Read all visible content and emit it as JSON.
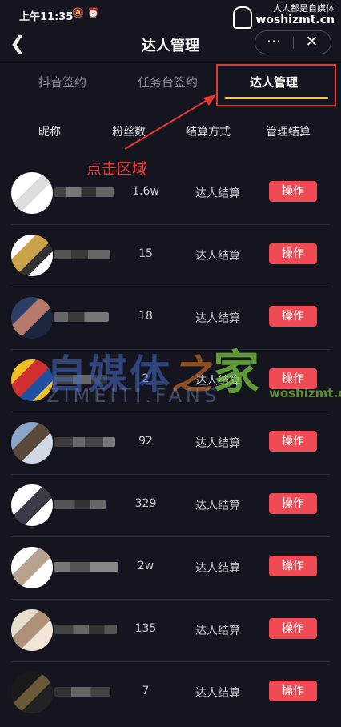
{
  "status_bar": {
    "time": "上午11:35"
  },
  "watermark_top": {
    "line1": "人人都是自媒体",
    "line2": "woshizmt.cn"
  },
  "nav": {
    "title": "达人管理",
    "more_label": "···"
  },
  "tabs": [
    {
      "label": "抖音签约",
      "selected": false
    },
    {
      "label": "任务台签约",
      "selected": false
    },
    {
      "label": "达人管理",
      "selected": true
    }
  ],
  "columns": [
    "昵称",
    "粉丝数",
    "结算方式",
    "管理结算"
  ],
  "annotation": "点击区域",
  "rows": [
    {
      "fans": "1.6w",
      "settle": "达人结算",
      "action": "操作"
    },
    {
      "fans": "15",
      "settle": "达人结算",
      "action": "操作"
    },
    {
      "fans": "18",
      "settle": "达人结算",
      "action": "操作"
    },
    {
      "fans": "2",
      "settle": "达人结算",
      "action": "操作"
    },
    {
      "fans": "92",
      "settle": "达人结算",
      "action": "操作"
    },
    {
      "fans": "329",
      "settle": "达人结算",
      "action": "操作"
    },
    {
      "fans": "2w",
      "settle": "达人结算",
      "action": "操作"
    },
    {
      "fans": "135",
      "settle": "达人结算",
      "action": "操作"
    },
    {
      "fans": "7",
      "settle": "达人结算",
      "action": "操作"
    }
  ],
  "watermark_center": {
    "main": "自媒体",
    "zhi": "之",
    "jia": "家",
    "fans": "ZIMEITI.FANS",
    "cn": "woshizmt.cn"
  },
  "colors": {
    "background": "#15151f",
    "accent_yellow": "#f5c518",
    "button_red": "#f04b55",
    "annotation_red": "#e53935"
  }
}
